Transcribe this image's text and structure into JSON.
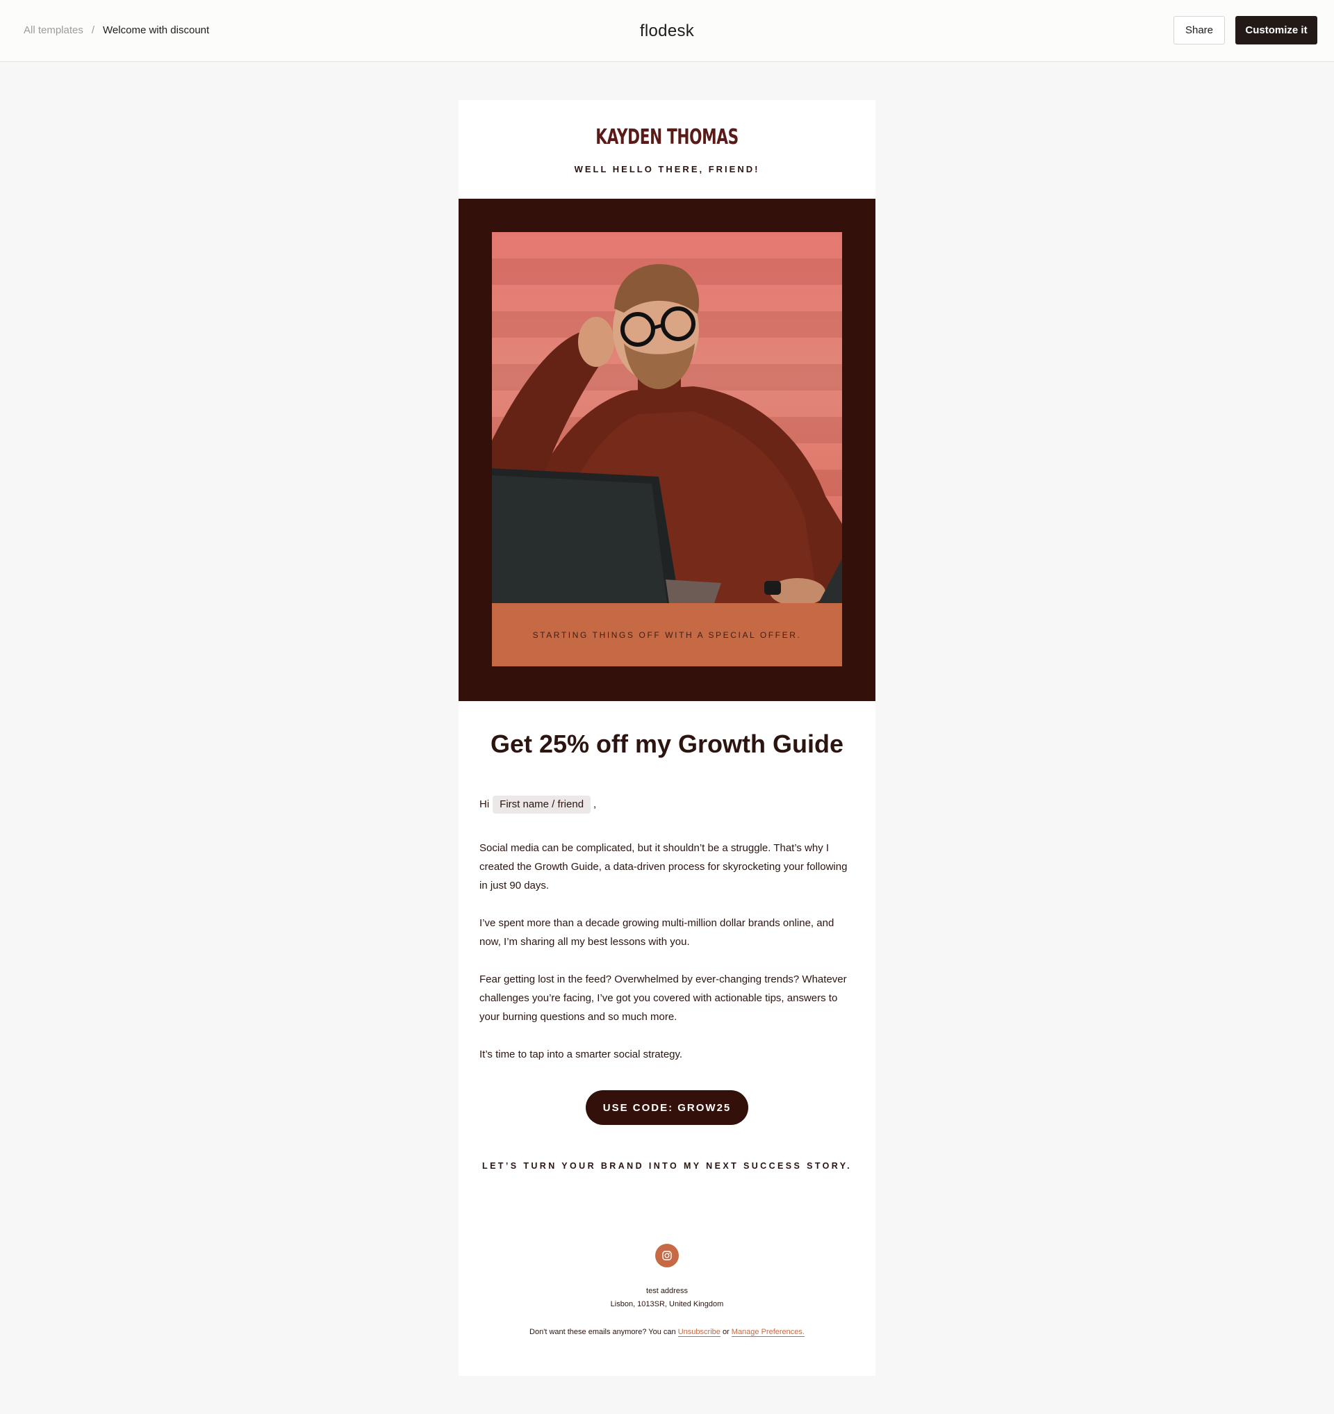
{
  "topbar": {
    "breadcrumb_parent": "All templates",
    "breadcrumb_separator": "/",
    "breadcrumb_current": "Welcome with discount",
    "logo": "flodesk",
    "share_label": "Share",
    "customize_label": "Customize it"
  },
  "email": {
    "brand_name": "KAYDEN THOMAS",
    "greeting": "WELL HELLO THERE, FRIEND!",
    "hero_caption": "STARTING THINGS OFF WITH A SPECIAL OFFER.",
    "headline": "Get 25% off my Growth Guide",
    "hi_prefix": "Hi",
    "merge_tag": "First name / friend",
    "hi_suffix": ",",
    "paragraphs": [
      "Social media can be complicated, but it shouldn’t be a struggle. That’s why I created the Growth Guide, a data-driven process for skyrocketing your following in just 90 days.",
      "I’ve spent more than a decade growing multi-million dollar brands online, and now, I’m sharing all my best lessons with you.",
      "Fear getting lost in the feed? Overwhelmed by ever-changing trends? Whatever challenges you’re facing, I’ve got you covered with actionable tips, answers to your burning questions and so much more.",
      "It’s time to tap into a smarter social strategy."
    ],
    "cta_label": "USE CODE: GROW25",
    "tagline": "LET’S TURN YOUR BRAND INTO MY NEXT SUCCESS STORY.",
    "social_icon": "instagram-icon",
    "address_line1": "test address",
    "address_line2": "Lisbon, 1013SR, United Kingdom",
    "footer_prefix": "Don't want these emails anymore? You can",
    "unsubscribe_label": "Unsubscribe",
    "footer_or": "or",
    "manage_label": "Manage Preferences."
  },
  "colors": {
    "accent_dark": "#33110a",
    "accent_orange": "#c56a45",
    "brand_red": "#5a1b18",
    "page_bg": "#f7f7f7"
  }
}
